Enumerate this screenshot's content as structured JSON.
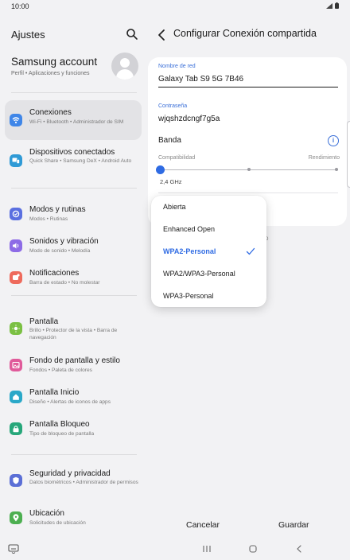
{
  "status_bar": {
    "time": "10:00"
  },
  "left_pane": {
    "title": "Ajustes",
    "account": {
      "name": "Samsung account",
      "subtitle": "Perfil  •  Aplicaciones y funciones"
    },
    "items": [
      {
        "title": "Conexiones",
        "subtitle": "Wi-Fi  •  Bluetooth  •  Administrador de SIM",
        "icon": "wifi-icon",
        "color": "#3f86e8",
        "active": true
      },
      {
        "title": "Dispositivos conectados",
        "subtitle": "Quick Share  •  Samsung DeX  •  Android Auto",
        "icon": "devices-icon",
        "color": "#2f9ad6"
      },
      {
        "title": "Modos y rutinas",
        "subtitle": "Modos  •  Rutinas",
        "icon": "routine-icon",
        "color": "#5a6fe0"
      },
      {
        "title": "Sonidos y vibración",
        "subtitle": "Modo de sonido  •  Melodía",
        "icon": "sound-icon",
        "color": "#8d6be6"
      },
      {
        "title": "Notificaciones",
        "subtitle": "Barra de estado  •  No molestar",
        "icon": "notification-icon",
        "color": "#ee6a5c"
      },
      {
        "title": "Pantalla",
        "subtitle": "Brillo  •  Protector de la vista  •  Barra de navegación",
        "icon": "display-icon",
        "color": "#7bc043"
      },
      {
        "title": "Fondo de pantalla y estilo",
        "subtitle": "Fondos  •  Paleta de colores",
        "icon": "wallpaper-icon",
        "color": "#e05a9a"
      },
      {
        "title": "Pantalla Inicio",
        "subtitle": "Diseño  •  Alertas de iconos de apps",
        "icon": "home-icon",
        "color": "#2aa8c8"
      },
      {
        "title": "Pantalla Bloqueo",
        "subtitle": "Tipo de bloqueo de pantalla",
        "icon": "lock-icon",
        "color": "#27a77a"
      },
      {
        "title": "Seguridad y privacidad",
        "subtitle": "Datos biométricos  •  Administrador de permisos",
        "icon": "shield-icon",
        "color": "#5b6fd6"
      },
      {
        "title": "Ubicación",
        "subtitle": "Solicitudes de ubicación",
        "icon": "location-icon",
        "color": "#4caf50"
      }
    ]
  },
  "right_pane": {
    "title": "Configurar Conexión compartida",
    "network_name": {
      "label": "Nombre de red",
      "value": "Galaxy Tab S9 5G 7B46"
    },
    "password": {
      "label": "Contraseña",
      "value": "wjqshzdcngf7g5a"
    },
    "band": {
      "title": "Banda",
      "left_label": "Compatibilidad",
      "right_label": "Rendimiento",
      "value": "2,4 GHz",
      "level": 0
    },
    "partial_text": "o",
    "security_dropdown": {
      "options": [
        "Abierta",
        "Enhanced Open",
        "WPA2-Personal",
        "WPA2/WPA3-Personal",
        "WPA3-Personal"
      ],
      "selected": "WPA2-Personal"
    },
    "cancel_label": "Cancelar",
    "save_label": "Guardar"
  },
  "colors": {
    "accent": "#2f6be3",
    "background": "#f2f2f4"
  }
}
